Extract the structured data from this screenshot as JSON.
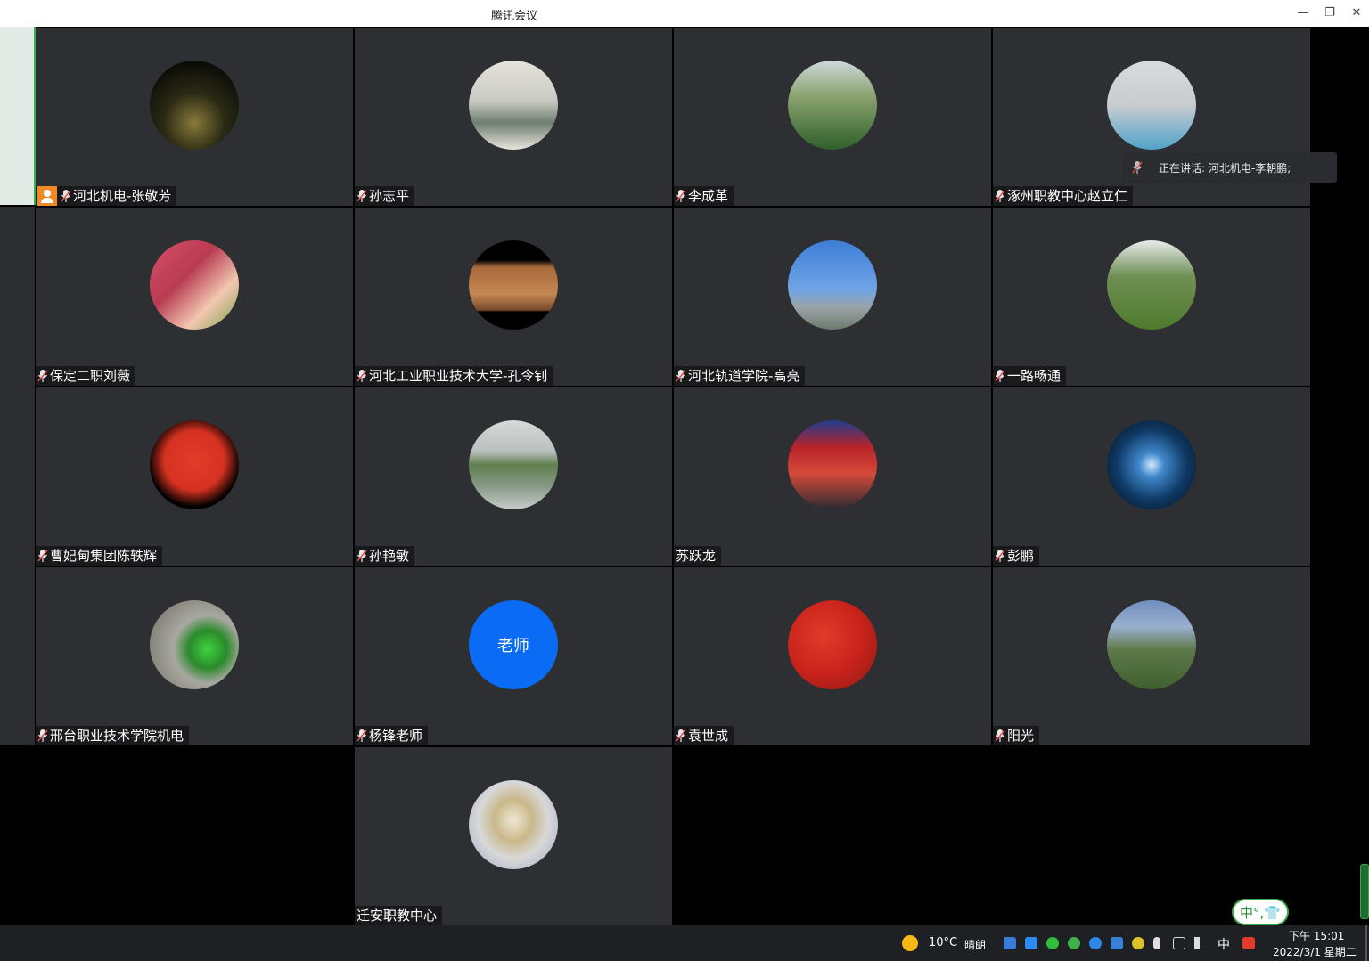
{
  "window": {
    "title": "腾讯会议",
    "controls": {
      "minimize": "—",
      "restore": "❐",
      "close": "✕"
    }
  },
  "participants": [
    {
      "name": "河北机电-张敬芳",
      "host": true,
      "muted_icon": true,
      "avatar": "night-city-trees"
    },
    {
      "name": "孙志平",
      "muted_icon": true,
      "avatar": "landscape-painting"
    },
    {
      "name": "李成革",
      "muted_icon": true,
      "avatar": "garden-pavilion"
    },
    {
      "name": "涿州职教中心赵立仁",
      "muted_icon": true,
      "avatar": "baby-photo"
    },
    {
      "name": "保定二职刘薇",
      "muted_icon": true,
      "avatar": "woman-tulips"
    },
    {
      "name": "河北工业职业技术大学-孔令钊",
      "muted_icon": true,
      "avatar": "desert-rover"
    },
    {
      "name": "河北轨道学院-高亮",
      "muted_icon": true,
      "avatar": "blue-sky-buildings"
    },
    {
      "name": "一路畅通",
      "muted_icon": true,
      "avatar": "person-on-grass"
    },
    {
      "name": "曹妃甸集团陈轶辉",
      "muted_icon": true,
      "avatar": "red-fox-cartoon"
    },
    {
      "name": "孙艳敏",
      "muted_icon": true,
      "avatar": "lake-reflection"
    },
    {
      "name": "苏跃龙",
      "muted_icon": false,
      "avatar": "man-at-gate"
    },
    {
      "name": "彭鹏",
      "muted_icon": true,
      "avatar": "blue-energy-sphere"
    },
    {
      "name": "邢台职业技术学院机电",
      "muted_icon": true,
      "avatar": "green-tea-cup"
    },
    {
      "name": "杨锋老师",
      "muted_icon": true,
      "avatar": "text-avatar",
      "avatar_text": "老师"
    },
    {
      "name": "袁世成",
      "muted_icon": true,
      "avatar": "china-flag-runner"
    },
    {
      "name": "阳光",
      "muted_icon": true,
      "avatar": "green-hills"
    },
    {
      "name": "迁安职教中心",
      "muted_icon": false,
      "avatar": "oval-emblem"
    }
  ],
  "speaking": {
    "text": "正在讲话: 河北机电-李朝鹏;"
  },
  "ime_indicator": {
    "label": "中°,👕"
  },
  "taskbar": {
    "temperature": "10°C",
    "weather": "晴朗",
    "ime": "中",
    "time": "下午 15:01",
    "date": "2022/3/1 星期二"
  },
  "colors": {
    "tile_bg": "#2d2f33",
    "host_badge": "#f08a24",
    "teacher_avatar": "#0a6cf5",
    "accent_green": "#3aa54b"
  }
}
